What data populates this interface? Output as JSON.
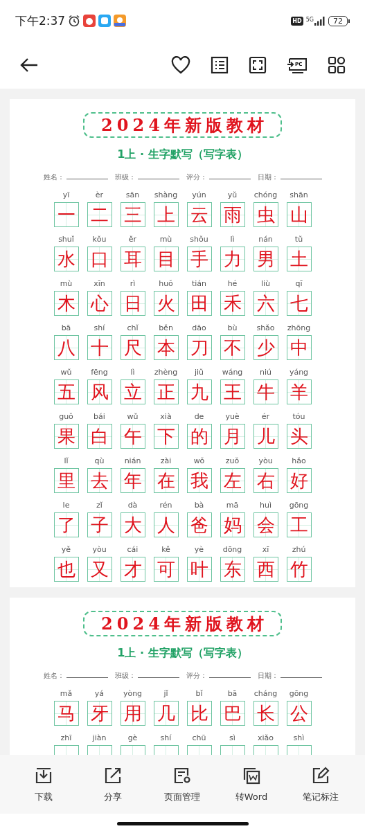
{
  "status_bar": {
    "time": "下午2:37",
    "hd_badge": "HD",
    "network": "5G",
    "battery": "72"
  },
  "top_bar": {
    "cast_label": "PC"
  },
  "pages": [
    {
      "title": "2024年新版教材",
      "subtitle": "1上 · 生字默写（写字表）",
      "form_fields": [
        {
          "label": "姓名："
        },
        {
          "label": "班级："
        },
        {
          "label": "评分："
        },
        {
          "label": "日期："
        }
      ],
      "characters": [
        {
          "pinyin": "yī",
          "hanzi": "一"
        },
        {
          "pinyin": "èr",
          "hanzi": "二"
        },
        {
          "pinyin": "sān",
          "hanzi": "三"
        },
        {
          "pinyin": "shàng",
          "hanzi": "上"
        },
        {
          "pinyin": "yún",
          "hanzi": "云"
        },
        {
          "pinyin": "yǔ",
          "hanzi": "雨"
        },
        {
          "pinyin": "chóng",
          "hanzi": "虫"
        },
        {
          "pinyin": "shān",
          "hanzi": "山"
        },
        {
          "pinyin": "shuǐ",
          "hanzi": "水"
        },
        {
          "pinyin": "kǒu",
          "hanzi": "口"
        },
        {
          "pinyin": "ěr",
          "hanzi": "耳"
        },
        {
          "pinyin": "mù",
          "hanzi": "目"
        },
        {
          "pinyin": "shǒu",
          "hanzi": "手"
        },
        {
          "pinyin": "lì",
          "hanzi": "力"
        },
        {
          "pinyin": "nán",
          "hanzi": "男"
        },
        {
          "pinyin": "tǔ",
          "hanzi": "土"
        },
        {
          "pinyin": "mù",
          "hanzi": "木"
        },
        {
          "pinyin": "xīn",
          "hanzi": "心"
        },
        {
          "pinyin": "rì",
          "hanzi": "日"
        },
        {
          "pinyin": "huǒ",
          "hanzi": "火"
        },
        {
          "pinyin": "tián",
          "hanzi": "田"
        },
        {
          "pinyin": "hé",
          "hanzi": "禾"
        },
        {
          "pinyin": "liù",
          "hanzi": "六"
        },
        {
          "pinyin": "qī",
          "hanzi": "七"
        },
        {
          "pinyin": "bā",
          "hanzi": "八"
        },
        {
          "pinyin": "shí",
          "hanzi": "十"
        },
        {
          "pinyin": "chǐ",
          "hanzi": "尺"
        },
        {
          "pinyin": "běn",
          "hanzi": "本"
        },
        {
          "pinyin": "dāo",
          "hanzi": "刀"
        },
        {
          "pinyin": "bù",
          "hanzi": "不"
        },
        {
          "pinyin": "shǎo",
          "hanzi": "少"
        },
        {
          "pinyin": "zhōng",
          "hanzi": "中"
        },
        {
          "pinyin": "wǔ",
          "hanzi": "五"
        },
        {
          "pinyin": "fēng",
          "hanzi": "风"
        },
        {
          "pinyin": "lì",
          "hanzi": "立"
        },
        {
          "pinyin": "zhèng",
          "hanzi": "正"
        },
        {
          "pinyin": "jiǔ",
          "hanzi": "九"
        },
        {
          "pinyin": "wáng",
          "hanzi": "王"
        },
        {
          "pinyin": "niú",
          "hanzi": "牛"
        },
        {
          "pinyin": "yáng",
          "hanzi": "羊"
        },
        {
          "pinyin": "guǒ",
          "hanzi": "果"
        },
        {
          "pinyin": "bái",
          "hanzi": "白"
        },
        {
          "pinyin": "wǔ",
          "hanzi": "午"
        },
        {
          "pinyin": "xià",
          "hanzi": "下"
        },
        {
          "pinyin": "de",
          "hanzi": "的"
        },
        {
          "pinyin": "yuè",
          "hanzi": "月"
        },
        {
          "pinyin": "ér",
          "hanzi": "儿"
        },
        {
          "pinyin": "tóu",
          "hanzi": "头"
        },
        {
          "pinyin": "lǐ",
          "hanzi": "里"
        },
        {
          "pinyin": "qù",
          "hanzi": "去"
        },
        {
          "pinyin": "nián",
          "hanzi": "年"
        },
        {
          "pinyin": "zài",
          "hanzi": "在"
        },
        {
          "pinyin": "wǒ",
          "hanzi": "我"
        },
        {
          "pinyin": "zuǒ",
          "hanzi": "左"
        },
        {
          "pinyin": "yòu",
          "hanzi": "右"
        },
        {
          "pinyin": "hǎo",
          "hanzi": "好"
        },
        {
          "pinyin": "le",
          "hanzi": "了"
        },
        {
          "pinyin": "zǐ",
          "hanzi": "子"
        },
        {
          "pinyin": "dà",
          "hanzi": "大"
        },
        {
          "pinyin": "rén",
          "hanzi": "人"
        },
        {
          "pinyin": "bà",
          "hanzi": "爸"
        },
        {
          "pinyin": "mā",
          "hanzi": "妈"
        },
        {
          "pinyin": "huì",
          "hanzi": "会"
        },
        {
          "pinyin": "gōng",
          "hanzi": "工"
        },
        {
          "pinyin": "yě",
          "hanzi": "也"
        },
        {
          "pinyin": "yòu",
          "hanzi": "又"
        },
        {
          "pinyin": "cái",
          "hanzi": "才"
        },
        {
          "pinyin": "kě",
          "hanzi": "可"
        },
        {
          "pinyin": "yè",
          "hanzi": "叶"
        },
        {
          "pinyin": "dōng",
          "hanzi": "东"
        },
        {
          "pinyin": "xī",
          "hanzi": "西"
        },
        {
          "pinyin": "zhú",
          "hanzi": "竹"
        }
      ]
    },
    {
      "title": "2024年新版教材",
      "subtitle": "1上 · 生字默写（写字表）",
      "form_fields": [
        {
          "label": "姓名："
        },
        {
          "label": "班级："
        },
        {
          "label": "评分："
        },
        {
          "label": "日期："
        }
      ],
      "characters": [
        {
          "pinyin": "mǎ",
          "hanzi": "马"
        },
        {
          "pinyin": "yá",
          "hanzi": "牙"
        },
        {
          "pinyin": "yòng",
          "hanzi": "用"
        },
        {
          "pinyin": "jǐ",
          "hanzi": "几"
        },
        {
          "pinyin": "bǐ",
          "hanzi": "比"
        },
        {
          "pinyin": "bā",
          "hanzi": "巴"
        },
        {
          "pinyin": "cháng",
          "hanzi": "长"
        },
        {
          "pinyin": "gōng",
          "hanzi": "公"
        },
        {
          "pinyin": "zhī"
        },
        {
          "pinyin": "jiàn"
        },
        {
          "pinyin": "gè"
        },
        {
          "pinyin": "shí"
        },
        {
          "pinyin": "chū"
        },
        {
          "pinyin": "sì"
        },
        {
          "pinyin": "xiǎo"
        },
        {
          "pinyin": "shì"
        }
      ]
    }
  ],
  "bottom_bar": {
    "actions": [
      {
        "kind": "download",
        "label": "下载"
      },
      {
        "kind": "share",
        "label": "分享"
      },
      {
        "kind": "pages",
        "label": "页面管理"
      },
      {
        "kind": "word",
        "label": "转Word"
      },
      {
        "kind": "annotate",
        "label": "笔记标注"
      }
    ]
  }
}
